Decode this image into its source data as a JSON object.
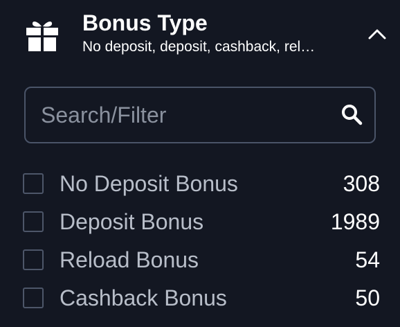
{
  "filter": {
    "icon": "gift-icon",
    "title": "Bonus Type",
    "subtitle": "No deposit, deposit, cashback, rel…",
    "toggle_icon": "chevron-up-icon",
    "expanded": true
  },
  "search": {
    "placeholder": "Search/Filter",
    "value": "",
    "icon": "search-icon"
  },
  "options": [
    {
      "label": "No Deposit Bonus",
      "count": "308",
      "checked": false
    },
    {
      "label": "Deposit Bonus",
      "count": "1989",
      "checked": false
    },
    {
      "label": "Reload Bonus",
      "count": "54",
      "checked": false
    },
    {
      "label": "Cashback Bonus",
      "count": "50",
      "checked": false
    }
  ],
  "colors": {
    "background": "#131722",
    "border": "#4a5468",
    "label": "#b8bec9",
    "text": "#ffffff",
    "placeholder": "#8a919e"
  }
}
